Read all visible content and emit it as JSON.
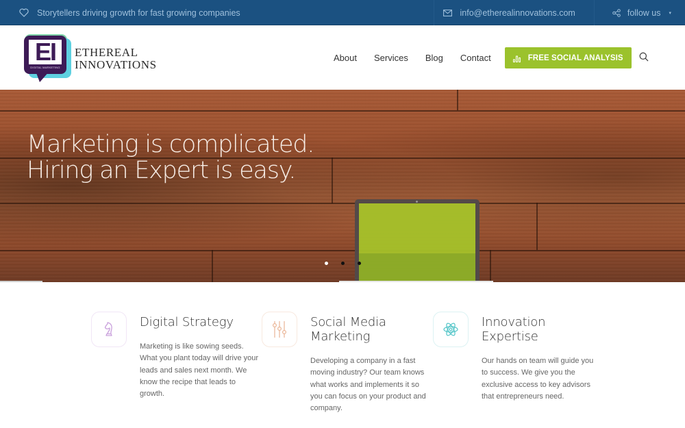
{
  "topbar": {
    "tagline": "Storytellers driving growth for fast growing companies",
    "tagline_icon": "heart-icon",
    "email": "info@etherealinnovations.com",
    "email_icon": "envelope-icon",
    "follow_label": "follow us",
    "follow_icon": "share-icon",
    "follow_caret": "▾"
  },
  "logo": {
    "initials": "EI",
    "subtext": "DIGITAL MARKETING",
    "line1": "ETHEREAL",
    "line2": "INNOVATIONS"
  },
  "nav": {
    "items": [
      {
        "label": "About"
      },
      {
        "label": "Services"
      },
      {
        "label": "Blog"
      },
      {
        "label": "Contact"
      }
    ],
    "cta_label": "FREE SOCIAL ANALYSIS",
    "cta_icon": "bar-chart-icon",
    "search_icon": "search-icon"
  },
  "hero": {
    "line1": "Marketing is complicated.",
    "line2": "Hiring an Expert is easy.",
    "slides": 3,
    "active_slide": 1
  },
  "features": [
    {
      "icon": "chess-knight-icon",
      "title": "Digital Strategy",
      "body": "Marketing is like sowing seeds. What you plant today will drive your leads and sales next month. We know the recipe that leads to growth.",
      "color": "#c9a0dc"
    },
    {
      "icon": "sliders-icon",
      "title": "Social Media Marketing",
      "body": "Developing a company in a fast moving industry? Our team knows what works and implements it so you can focus on your product and company.",
      "color": "#eab596"
    },
    {
      "icon": "atom-icon",
      "title": "Innovation Expertise",
      "body": "Our hands on team will guide you to success. We give you the exclusive access to key advisors that entrepreneurs need.",
      "color": "#4fc4c7"
    }
  ],
  "colors": {
    "topbar_bg": "#1b5181",
    "cta_bg": "#9bc22c",
    "logo_purple": "#3d1b56"
  }
}
